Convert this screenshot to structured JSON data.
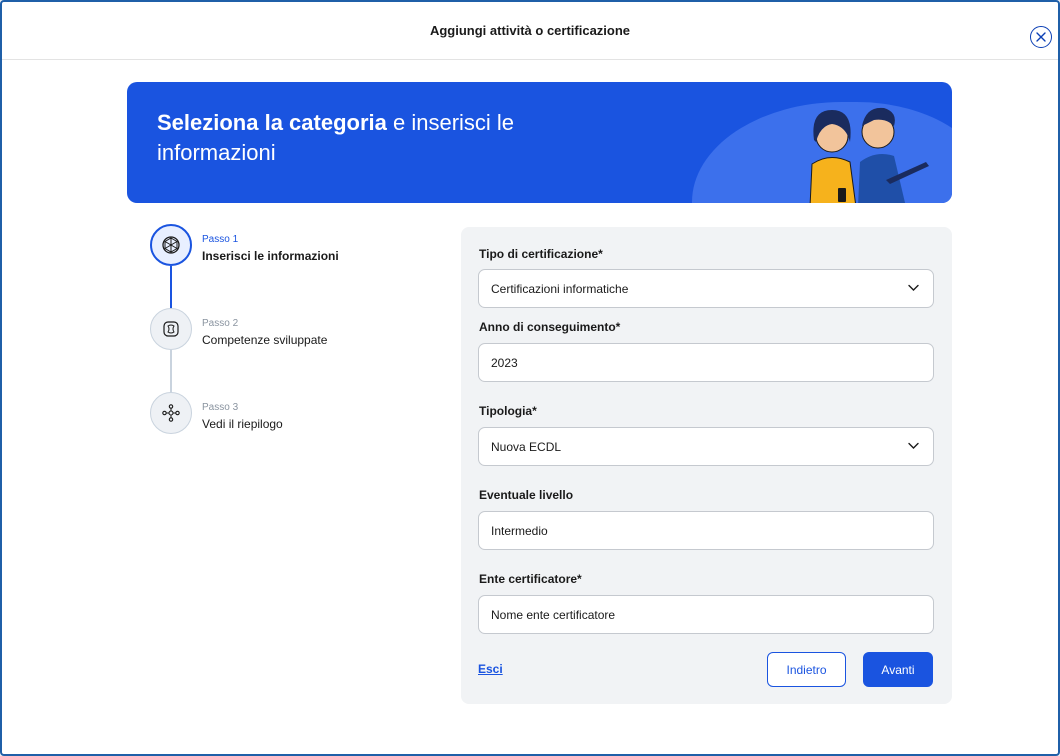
{
  "modal": {
    "title": "Aggiungi attività o certificazione"
  },
  "banner": {
    "title_bold": "Seleziona la categoria",
    "title_rest": " e inserisci le informazioni"
  },
  "stepper": {
    "steps": [
      {
        "number": "Passo 1",
        "label": "Inserisci le informazioni",
        "state": "active"
      },
      {
        "number": "Passo 2",
        "label": "Competenze sviluppate",
        "state": "inactive"
      },
      {
        "number": "Passo 3",
        "label": "Vedi il riepilogo",
        "state": "inactive"
      }
    ]
  },
  "form": {
    "certification_type": {
      "label": "Tipo di certificazione*",
      "value": "Certificazioni informatiche"
    },
    "year": {
      "label": "Anno di conseguimento*",
      "value": "2023"
    },
    "typology": {
      "label": "Tipologia*",
      "value": "Nuova ECDL"
    },
    "level": {
      "label": "Eventuale livello",
      "value": "Intermedio"
    },
    "certifier": {
      "label": "Ente certificatore*",
      "value": "Nome ente certificatore"
    },
    "exit_label": "Esci",
    "back_label": "Indietro",
    "next_label": "Avanti"
  },
  "icons": {
    "close": "close-icon",
    "step1": "cube-icon",
    "step2": "skills-icon",
    "step3": "network-icon",
    "dropdown": "chevron-down-icon"
  },
  "colors": {
    "primary": "#1a54e0",
    "panel": "#f1f3f5",
    "border": "#1f5fa8"
  }
}
